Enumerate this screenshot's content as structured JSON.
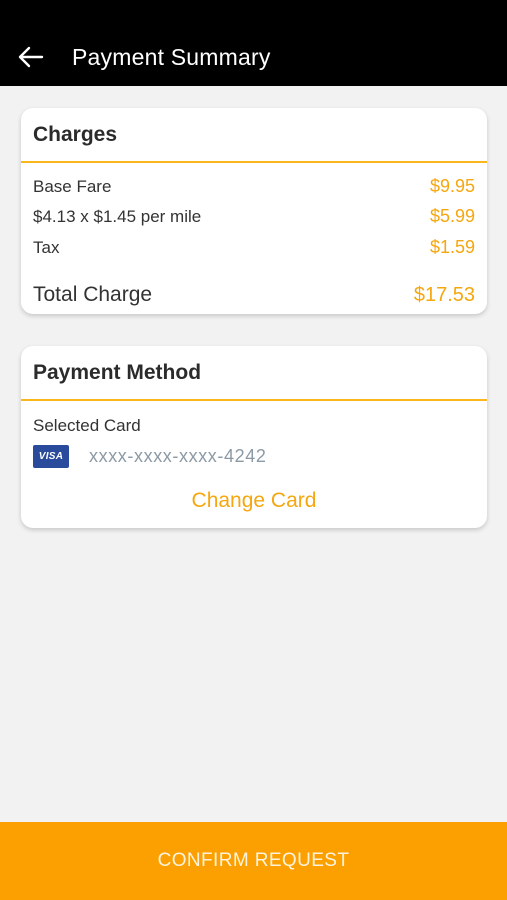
{
  "header": {
    "title": "Payment Summary",
    "back_icon": "back-arrow-icon"
  },
  "charges": {
    "title": "Charges",
    "rows": [
      {
        "label": "Base Fare",
        "amount": "$9.95"
      },
      {
        "label": "$4.13 x $1.45 per mile",
        "amount": "$5.99"
      },
      {
        "label": "Tax",
        "amount": "$1.59"
      }
    ],
    "total": {
      "label": "Total Charge",
      "amount": "$17.53"
    }
  },
  "payment_method": {
    "title": "Payment Method",
    "selected_label": "Selected Card",
    "card_brand": "VISA",
    "card_number": "xxxx-xxxx-xxxx-4242",
    "change_label": "Change Card"
  },
  "footer": {
    "confirm_label": "CONFIRM REQUEST"
  },
  "colors": {
    "accent": "#f5a70f",
    "button": "#fba000",
    "header_bg": "#000000",
    "visa": "#2a4a9c"
  }
}
